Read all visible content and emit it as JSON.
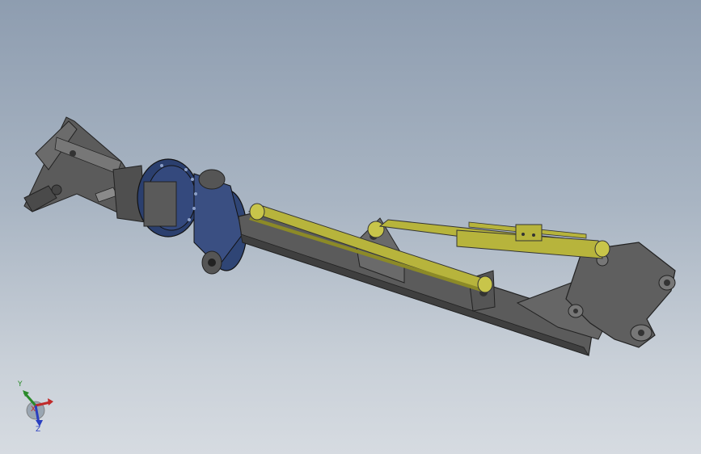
{
  "viewport": {
    "background_top": "#8e9db0",
    "background_bottom": "#d6dbe1"
  },
  "model": {
    "parts": [
      "mounting-bracket",
      "rotary-drive",
      "boom-arm",
      "hydraulic-cylinder-upper",
      "hydraulic-cylinder-lower",
      "end-effector-mount"
    ],
    "colors": {
      "frame": "#5b5b5b",
      "frame_dark": "#3f3f3f",
      "drive": "#2b3f6e",
      "cylinder": "#b7b43c",
      "cylinder_dark": "#8c8a27"
    }
  },
  "triad": {
    "x_label": "X",
    "y_label": "Y",
    "z_label": "Z",
    "x_color": "#c02a2a",
    "y_color": "#2a8a2a",
    "z_color": "#2a3fc0"
  }
}
